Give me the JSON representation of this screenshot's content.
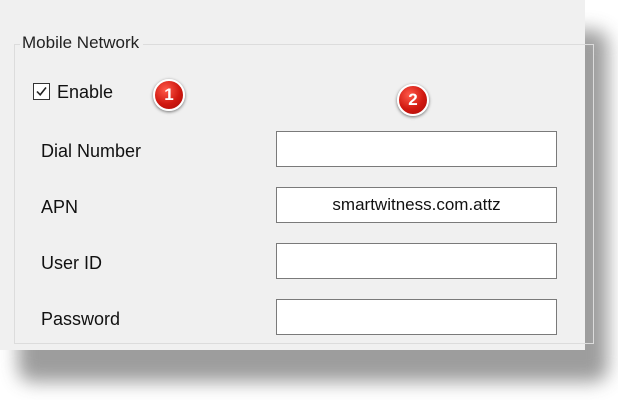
{
  "group": {
    "title": "Mobile Network"
  },
  "enable": {
    "label": "Enable",
    "checked": true
  },
  "annotations": [
    {
      "number": "1"
    },
    {
      "number": "2"
    }
  ],
  "fields": [
    {
      "label": "Dial Number",
      "value": ""
    },
    {
      "label": "APN",
      "value": "smartwitness.com.attz"
    },
    {
      "label": "User ID",
      "value": ""
    },
    {
      "label": "Password",
      "value": ""
    }
  ],
  "colors": {
    "panel_bg": "#f0f0f0",
    "badge": "#d01810"
  }
}
